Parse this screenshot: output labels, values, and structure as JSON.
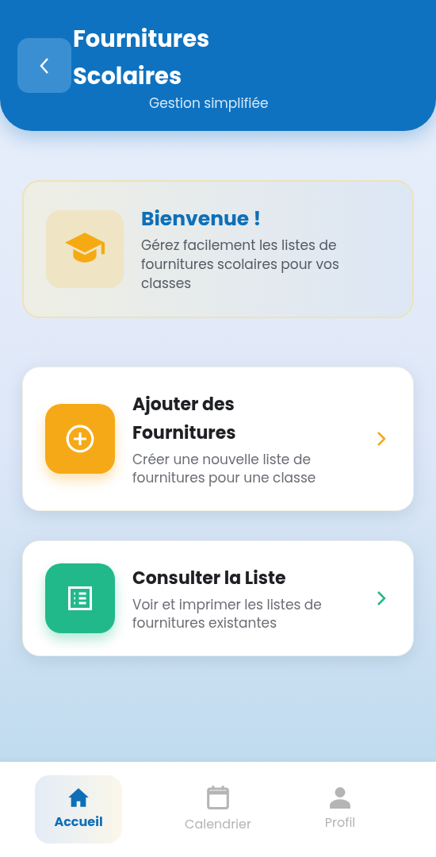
{
  "header": {
    "title": "Fournitures Scolaires",
    "subtitle": "Gestion simplifiée"
  },
  "welcome": {
    "title": "Bienvenue !",
    "text": "Gérez facilement les listes de fournitures scolaires pour vos classes"
  },
  "actions": [
    {
      "kind": "add",
      "title": "Ajouter des Fournitures",
      "text": "Créer une nouvelle liste de fournitures pour une classe",
      "color": "#f6a917"
    },
    {
      "kind": "list",
      "title": "Consulter la Liste",
      "text": "Voir et imprimer les listes de fournitures existantes",
      "color": "#22b98a"
    }
  ],
  "nav": [
    {
      "kind": "home",
      "label": "Accueil",
      "selected": true
    },
    {
      "kind": "calendar",
      "label": "Calendrier",
      "selected": false
    },
    {
      "kind": "profile",
      "label": "Profil",
      "selected": false
    }
  ]
}
